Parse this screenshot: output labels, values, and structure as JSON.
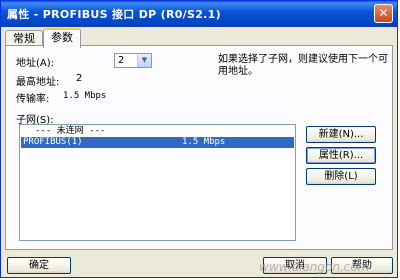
{
  "window": {
    "title": "属性 - PROFIBUS 接口  DP (R0/S2.1)",
    "close_glyph": "✕"
  },
  "tabs": [
    "常规",
    "参数"
  ],
  "address": {
    "label": "地址(A):",
    "value": "2"
  },
  "highest_address": {
    "label": "最高地址:",
    "value": "2"
  },
  "transmission_rate": {
    "label": "传输率:",
    "value": "1.5 Mbps"
  },
  "hint": "如果选择了子网，则建议使用下一个可用地址。",
  "subnet": {
    "label": "子网(S):",
    "rows": [
      {
        "name": "--- 未连网 ---",
        "rate": ""
      },
      {
        "name": "PROFIBUS(1)",
        "rate": "1.5 Mbps",
        "selected": true
      }
    ]
  },
  "buttons": {
    "new": "新建(N)...",
    "properties": "属性(R)...",
    "delete": "删除(L)",
    "ok": "确定",
    "cancel": "取消",
    "help": "帮助"
  },
  "watermark": "www.diangon.com"
}
